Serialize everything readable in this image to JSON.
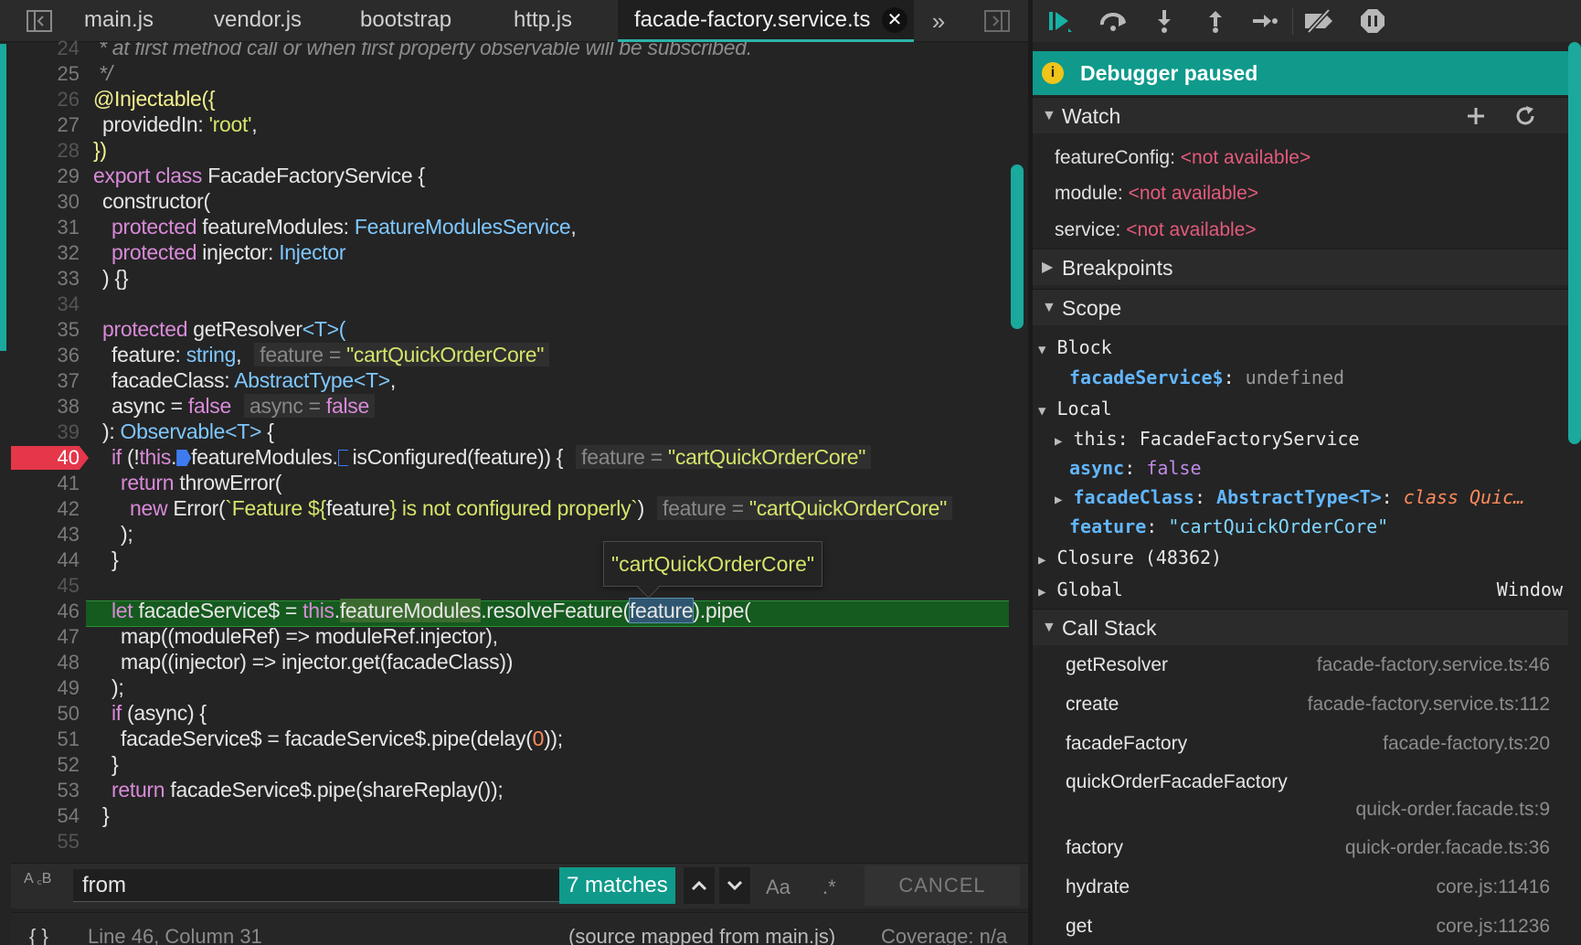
{
  "tabs": [
    {
      "label": "main.js"
    },
    {
      "label": "vendor.js"
    },
    {
      "label": "bootstrap"
    },
    {
      "label": "http.js"
    },
    {
      "label": "facade-factory.service.ts",
      "active": true
    }
  ],
  "gutter": [
    "24",
    "25",
    "26",
    "27",
    "28",
    "29",
    "30",
    "31",
    "32",
    "33",
    "34",
    "35",
    "36",
    "37",
    "38",
    "39",
    "40",
    "41",
    "42",
    "43",
    "44",
    "45",
    "46",
    "47",
    "48",
    "49",
    "50",
    "51",
    "52",
    "53",
    "54",
    "55"
  ],
  "breakpoint_line": "40",
  "code": {
    "l24": "* at first method call or when first property observable will be subscribed.",
    "l25": "*/",
    "l26": [
      "@Injectable({"
    ],
    "l27": [
      "providedIn: ",
      "'root'",
      ","
    ],
    "l28": "})",
    "l29": [
      "export class",
      " FacadeFactoryService {"
    ],
    "l30": "constructor(",
    "l31": [
      "protected",
      " featureModules: ",
      "FeatureModulesService",
      ","
    ],
    "l32": [
      "protected",
      " injector: ",
      "Injector"
    ],
    "l33": ") {}",
    "l35": [
      "protected",
      " getResolver",
      "<T>("
    ],
    "l36": [
      "feature: ",
      "string",
      ","
    ],
    "l36_inline": [
      "feature = ",
      "\"cartQuickOrderCore\""
    ],
    "l37": [
      "facadeClass: ",
      "AbstractType<T>",
      ","
    ],
    "l38": [
      "async = ",
      "false"
    ],
    "l38_inline": [
      "async = ",
      "false"
    ],
    "l39": [
      "): ",
      "Observable<T>",
      " {"
    ],
    "l40": [
      "if",
      " (!",
      "this",
      ".",
      "featureModules.",
      "isConfigured(feature)) {"
    ],
    "l40_inline": [
      "feature = ",
      "\"cartQuickOrderCore\""
    ],
    "l41": [
      "return",
      " throwError("
    ],
    "l42": [
      "new",
      " Error(",
      "`Feature ${",
      "feature",
      "} is not configured properly`",
      ")"
    ],
    "l42_inline": [
      "feature = ",
      "\"cartQuickOrderCore\""
    ],
    "l43": ");",
    "l44": "}",
    "l46": [
      "let",
      " facadeService$ = ",
      "this",
      ".",
      "featureModules",
      ".resolveFeature(",
      "feature",
      ").pipe("
    ],
    "l47": [
      "map((moduleRef) => moduleRef.injector),"
    ],
    "l48": [
      "map((injector) => injector.get(facadeClass))"
    ],
    "l49": ");",
    "l50": [
      "if",
      " (async) {"
    ],
    "l51": [
      "facadeService$ = facadeService$.pipe(delay(",
      "0",
      "));"
    ],
    "l52": "}",
    "l53": [
      "return",
      " facadeService$.pipe(shareReplay());"
    ],
    "l54": "}"
  },
  "tooltip": "\"cartQuickOrderCore\"",
  "search": {
    "icon_text": "A ꜀B",
    "value": "from",
    "matches": "7 matches",
    "case_label": "Aa",
    "regex_label": ".*",
    "cancel": "CANCEL"
  },
  "status": {
    "braces": "{ }",
    "position": "Line 46, Column 31",
    "source_map": "(source mapped from main.js)",
    "coverage": "Coverage: n/a"
  },
  "debugger": {
    "banner": "Debugger paused",
    "banner_icon": "i",
    "sections": {
      "watch": "Watch",
      "breakpoints": "Breakpoints",
      "scope": "Scope",
      "call_stack": "Call Stack"
    },
    "watch": [
      {
        "name": "featureConfig",
        "value": "<not available>"
      },
      {
        "name": "module",
        "value": "<not available>"
      },
      {
        "name": "service",
        "value": "<not available>"
      }
    ],
    "scope": {
      "block": "Block",
      "block_var": "facadeService$",
      "block_val": "undefined",
      "local": "Local",
      "this_key": "this",
      "this_val": "FacadeFactoryService",
      "async_key": "async",
      "async_val": "false",
      "fc_key": "facadeClass",
      "fc_type": "AbstractType<T>",
      "fc_val": "class Quic…",
      "feat_key": "feature",
      "feat_val": "\"cartQuickOrderCore\"",
      "closure": "Closure (48362)",
      "global": "Global",
      "global_val": "Window"
    },
    "call_stack": [
      {
        "fn": "getResolver",
        "loc": "facade-factory.service.ts:46"
      },
      {
        "fn": "create",
        "loc": "facade-factory.service.ts:112"
      },
      {
        "fn": "facadeFactory",
        "loc": "facade-factory.ts:20"
      },
      {
        "fn": "quickOrderFacadeFactory",
        "loc": "quick-order.facade.ts:9"
      },
      {
        "fn": "factory",
        "loc": "quick-order.facade.ts:36"
      },
      {
        "fn": "hydrate",
        "loc": "core.js:11416"
      },
      {
        "fn": "get",
        "loc": "core.js:11236"
      }
    ]
  },
  "colors": {
    "accent": "#0f9a8b",
    "breakpoint": "#e5364a",
    "paused_line": "#155a1e"
  },
  "icons": [
    "sidebar-toggle-icon",
    "close-icon",
    "chevron-double-right-icon",
    "panel-toggle-icon",
    "resume-icon",
    "step-over-icon",
    "step-into-icon",
    "step-out-icon",
    "step-icon",
    "deactivate-breakpoints-icon",
    "pause-on-exceptions-icon",
    "plus-icon",
    "refresh-icon",
    "info-icon",
    "chevron-up-icon",
    "chevron-down-icon"
  ]
}
